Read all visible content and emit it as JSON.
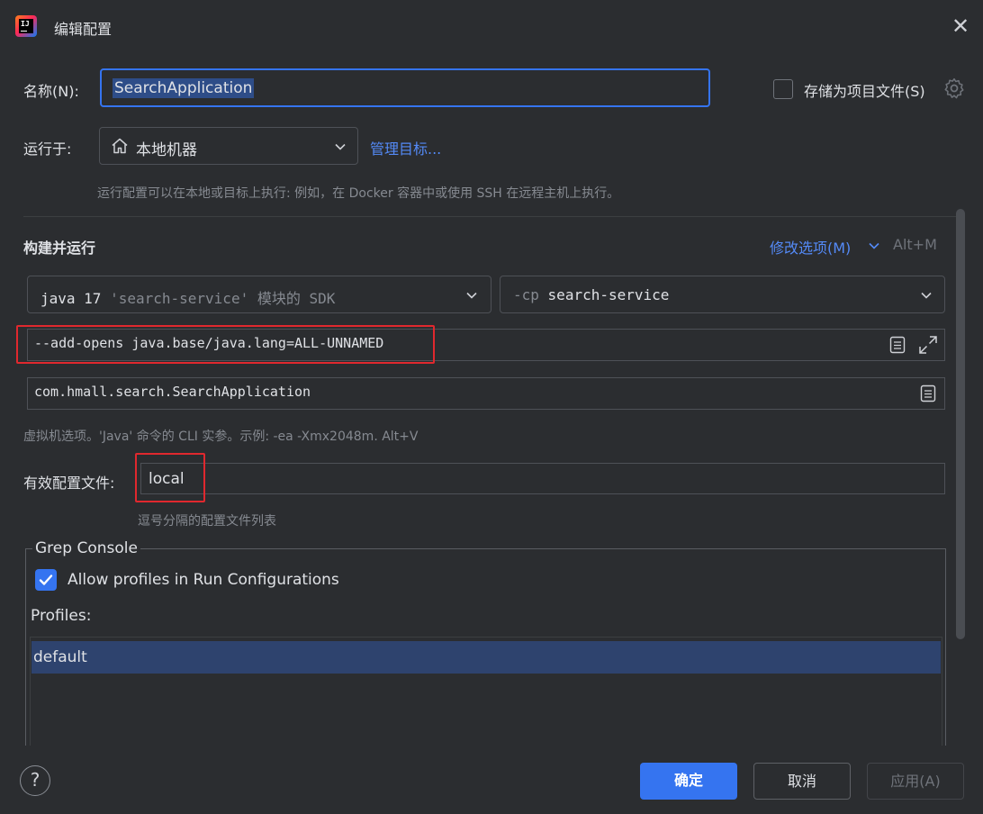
{
  "window": {
    "title": "编辑配置",
    "close_glyph": "✕"
  },
  "name_row": {
    "label": "名称(N):",
    "value": "SearchApplication",
    "store_as_project_file": "存储为项目文件(S)",
    "store_checked": false
  },
  "run_on": {
    "label": "运行于:",
    "value": "本地机器",
    "manage_link": "管理目标...",
    "hint": "运行配置可以在本地或目标上执行: 例如，在 Docker 容器中或使用 SSH 在远程主机上执行。"
  },
  "build_run": {
    "title": "构建并运行",
    "modify_options": "修改选项(M)",
    "modify_shortcut": "Alt+M",
    "sdk": {
      "main": "java 17",
      "detail": "'search-service' 模块的 SDK"
    },
    "classpath": {
      "flag": "-cp",
      "value": "search-service"
    },
    "vm_options": "--add-opens java.base/java.lang=ALL-UNNAMED",
    "main_class": "com.hmall.search.SearchApplication",
    "vm_hint": "虚拟机选项。'Java' 命令的 CLI 实参。示例: -ea -Xmx2048m. Alt+V"
  },
  "profiles_row": {
    "label": "有效配置文件:",
    "value": "local",
    "hint": "逗号分隔的配置文件列表"
  },
  "grep_console": {
    "legend": "Grep Console",
    "allow_label": "Allow profiles in Run Configurations",
    "allow_checked": true,
    "profiles_label": "Profiles:",
    "profiles": [
      "default"
    ]
  },
  "footer": {
    "help": "?",
    "ok": "确定",
    "cancel": "取消",
    "apply": "应用(A)"
  },
  "colors": {
    "accent": "#3574f0",
    "link": "#548af7",
    "highlight_box": "#e0282e",
    "selection": "#2e436e"
  }
}
